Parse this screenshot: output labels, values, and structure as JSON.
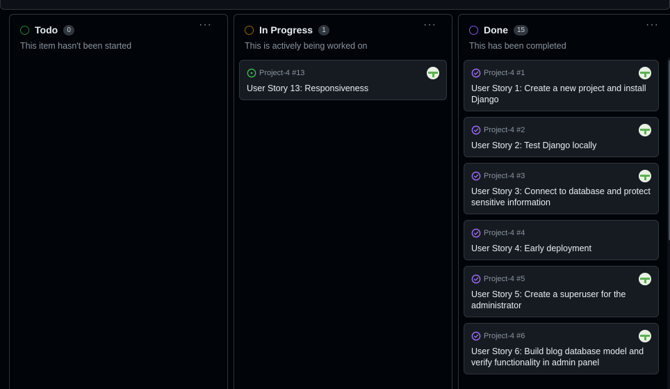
{
  "columns": {
    "todo": {
      "title": "Todo",
      "count": "0",
      "description": "This item hasn't been started",
      "more": "···",
      "dot_color": "#238636"
    },
    "progress": {
      "title": "In Progress",
      "count": "1",
      "description": "This is actively being worked on",
      "more": "···",
      "dot_color": "#9e6a03",
      "cards": [
        {
          "ref": "Project-4 #13",
          "title": "User Story 13: Responsiveness",
          "icon": "issue-open-icon"
        }
      ]
    },
    "done": {
      "title": "Done",
      "count": "15",
      "description": "This has been completed",
      "more": "···",
      "dot_color": "#8957e5",
      "cards": [
        {
          "ref": "Project-4 #1",
          "title": "User Story 1: Create a new project and install Django",
          "icon": "issue-closed-icon"
        },
        {
          "ref": "Project-4 #2",
          "title": "User Story 2: Test Django locally",
          "icon": "issue-closed-icon"
        },
        {
          "ref": "Project-4 #3",
          "title": "User Story 3: Connect to database and protect sensitive information",
          "icon": "issue-closed-icon"
        },
        {
          "ref": "Project-4 #4",
          "title": "User Story 4: Early deployment",
          "icon": "issue-closed-icon"
        },
        {
          "ref": "Project-4 #5",
          "title": "User Story 5: Create a superuser for the administrator",
          "icon": "issue-closed-icon"
        },
        {
          "ref": "Project-4 #6",
          "title": "User Story 6: Build blog database model and verify functionality in admin panel",
          "icon": "issue-closed-icon"
        }
      ]
    }
  },
  "colors": {
    "open": "#3fb950",
    "closed": "#a371f7"
  }
}
